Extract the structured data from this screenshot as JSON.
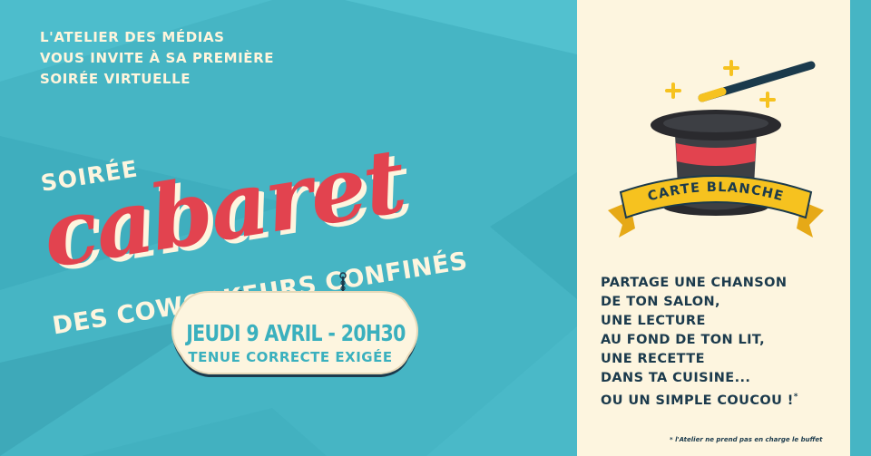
{
  "invitation": {
    "line1": "L'ATELIER DES MÉDIAS",
    "line2": "VOUS INVITE À SA PREMIÈRE",
    "line3": "SOIRÉE VIRTUELLE"
  },
  "title": {
    "prefix": "SOIRÉE",
    "main": "cabaret",
    "subtitle": "DES COWORKEURS CONFINÉS"
  },
  "sign": {
    "date": "JEUDI 9 AVRIL - 20H30",
    "dress_code": "TENUE CORRECTE EXIGÉE"
  },
  "carte_blanche": {
    "banner": "CARTE BLANCHE",
    "lines": [
      "PARTAGE UNE CHANSON",
      "DE TON SALON,",
      "UNE LECTURE",
      "AU FOND DE TON LIT,",
      "UNE RECETTE",
      "DANS TA CUISINE...",
      "OU UN SIMPLE COUCOU !"
    ],
    "asterisk": "*",
    "footnote": "* l'Atelier ne prend pas en charge le buffet"
  },
  "colors": {
    "teal": "#46b5c4",
    "cream": "#fdf5df",
    "red": "#e2434f",
    "navy": "#1b3a4c",
    "yellow": "#f6c21f"
  }
}
